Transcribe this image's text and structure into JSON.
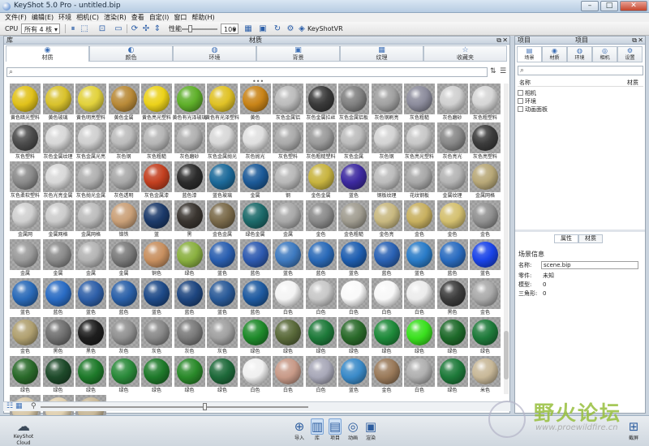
{
  "window": {
    "title": "KeyShot 5.0 Pro - untitled.bip",
    "minimize": "–",
    "maximize": "□",
    "close": "✕"
  },
  "menu": [
    "文件(F)",
    "编辑(E)",
    "环境",
    "相机(C)",
    "渲染(R)",
    "查看",
    "自定(I)",
    "窗口",
    "帮助(H)"
  ],
  "toolbar": {
    "cpu_label": "CPU",
    "cpu_value": "所有 4 核",
    "perf_label": "性能",
    "zoom_value": "100",
    "keyshotvr": "KeyShotVR"
  },
  "library": {
    "header_title": "库",
    "center_title": "材质",
    "tabs": [
      {
        "icon": "◉",
        "label": "材质"
      },
      {
        "icon": "◐",
        "label": "颜色"
      },
      {
        "icon": "◍",
        "label": "环境"
      },
      {
        "icon": "▣",
        "label": "背景"
      },
      {
        "icon": "▦",
        "label": "纹理"
      },
      {
        "icon": "☆",
        "label": "收藏夹"
      }
    ],
    "search_icon": "⌕",
    "sort_icons": [
      "⇅",
      "☰"
    ]
  },
  "materials": [
    {
      "label": "黄色暗光塑料",
      "color": "#e1c21a"
    },
    {
      "label": "黄色玻璃",
      "color": "#d9c22c"
    },
    {
      "label": "黄色明亮塑料",
      "color": "#e2d23c"
    },
    {
      "label": "黄色金属",
      "color": "#b98a38"
    },
    {
      "label": "黄色亮光塑料",
      "color": "#ecd21a"
    },
    {
      "label": "黄色有光泽玻璃",
      "color": "#5fb02a"
    },
    {
      "label": "黄色有光泽塑料",
      "color": "#e0c226"
    },
    {
      "label": "黄色",
      "color": "#c98418"
    },
    {
      "label": "灰色金属铝",
      "color": "#bcbcbc"
    },
    {
      "label": "灰色金属拉丝",
      "color": "#3a3a3a"
    },
    {
      "label": "灰色金属铝板",
      "color": "#808080"
    },
    {
      "label": "灰色钢刷亮",
      "color": "#a0a0a0"
    },
    {
      "label": "灰色粗糙",
      "color": "#8c8c9c"
    },
    {
      "label": "灰色磨砂",
      "color": "#d0d0d0"
    },
    {
      "label": "灰色粗塑料",
      "color": "#d6d6d6"
    },
    {
      "label": "灰色塑料",
      "color": "#4c4c4c"
    },
    {
      "label": "灰色金属纹理",
      "color": "#d8d8d8"
    },
    {
      "label": "灰色金属光亮",
      "color": "#d0d0d0"
    },
    {
      "label": "灰色钢",
      "color": "#bcbcbc"
    },
    {
      "label": "灰色粗糙",
      "color": "#b6b6b6"
    },
    {
      "label": "灰色磨砂",
      "color": "#b0b0b0"
    },
    {
      "label": "灰色金属抛光",
      "color": "#d8d8d8"
    },
    {
      "label": "灰色抛光",
      "color": "#e0e0e0"
    },
    {
      "label": "灰色塑料",
      "color": "#aaaaaa"
    },
    {
      "label": "灰色粗糙塑料",
      "color": "#9a9a9a"
    },
    {
      "label": "灰色金属",
      "color": "#bcbcbc"
    },
    {
      "label": "灰色钢",
      "color": "#d4d4d4"
    },
    {
      "label": "灰色亮光塑料",
      "color": "#c8c8c8"
    },
    {
      "label": "灰色亮光",
      "color": "#888888"
    },
    {
      "label": "灰色亮塑料",
      "color": "#3c3c3c"
    },
    {
      "label": "灰色柔软塑料",
      "color": "#8a8a8a"
    },
    {
      "label": "灰色光亮金属",
      "color": "#d8d8d8"
    },
    {
      "label": "灰色抛光金属",
      "color": "#b0b0b0"
    },
    {
      "label": "灰色透明",
      "color": "#a8a8a8"
    },
    {
      "label": "灰色金属漆",
      "color": "#c34020"
    },
    {
      "label": "蓝色漆",
      "color": "#2c2c2c"
    },
    {
      "label": "蓝色玻璃",
      "color": "#1c6a9a"
    },
    {
      "label": "金属",
      "color": "#1c5a98"
    },
    {
      "label": "钢",
      "color": "#b8b8b8"
    },
    {
      "label": "金色金属",
      "color": "#c8b440"
    },
    {
      "label": "蓝色",
      "color": "#3d2aa0"
    },
    {
      "label": "钢板纹理",
      "color": "#bcbcbc"
    },
    {
      "label": "花纹钢板",
      "color": "#a8a8a8"
    },
    {
      "label": "金属纹理",
      "color": "#b4b4b4"
    },
    {
      "label": "金属网格",
      "color": "#b8a878"
    },
    {
      "label": "金属网",
      "color": "#d0d0d0"
    },
    {
      "label": "金属网格",
      "color": "#cccccc"
    },
    {
      "label": "金属网格",
      "color": "#bcbcbc"
    },
    {
      "label": "铬铁",
      "color": "#caa078"
    },
    {
      "label": "蓝",
      "color": "#1c3a6a"
    },
    {
      "label": "黑",
      "color": "#3a3530"
    },
    {
      "label": "金色金属",
      "color": "#7a6a4a"
    },
    {
      "label": "绿色金属",
      "color": "#1c6a6a"
    },
    {
      "label": "金属",
      "color": "#a8a8a8"
    },
    {
      "label": "金色",
      "color": "#8a8a8a"
    },
    {
      "label": "金色粗糙",
      "color": "#a09c90"
    },
    {
      "label": "金色亮",
      "color": "#c8b880"
    },
    {
      "label": "金色",
      "color": "#c8b060"
    },
    {
      "label": "金色",
      "color": "#d4c070"
    },
    {
      "label": "金色",
      "color": "#909090"
    },
    {
      "label": "金属",
      "color": "#9a9a9a"
    },
    {
      "label": "金属",
      "color": "#8a8a8a"
    },
    {
      "label": "金属",
      "color": "#b4b4b4"
    },
    {
      "label": "金属",
      "color": "#7a7a7a"
    },
    {
      "label": "铜色",
      "color": "#c89060"
    },
    {
      "label": "绿色",
      "color": "#8ab040"
    },
    {
      "label": "蓝色",
      "color": "#2a5fb0"
    },
    {
      "label": "蓝色",
      "color": "#2e5ab0"
    },
    {
      "label": "蓝色",
      "color": "#3e7ac0"
    },
    {
      "label": "蓝色",
      "color": "#2a6ab8"
    },
    {
      "label": "蓝色",
      "color": "#1e5eb0"
    },
    {
      "label": "蓝色",
      "color": "#2a62b4"
    },
    {
      "label": "蓝色",
      "color": "#2a7cc8"
    },
    {
      "label": "蓝色",
      "color": "#2a6cc0"
    },
    {
      "label": "蓝色",
      "color": "#1a44e8"
    },
    {
      "label": "蓝色",
      "color": "#2a6ab8"
    },
    {
      "label": "蓝色",
      "color": "#2a6cc4"
    },
    {
      "label": "蓝色",
      "color": "#2e5fa8"
    },
    {
      "label": "蓝色",
      "color": "#2a60a8"
    },
    {
      "label": "蓝色",
      "color": "#1e4a88"
    },
    {
      "label": "蓝色",
      "color": "#1e4680"
    },
    {
      "label": "蓝色",
      "color": "#2a5a98"
    },
    {
      "label": "蓝色",
      "color": "#1e5aa0"
    },
    {
      "label": "白色",
      "color": "#f4f4f4"
    },
    {
      "label": "白色",
      "color": "#c8c8c8"
    },
    {
      "label": "白色",
      "color": "#fafafa"
    },
    {
      "label": "白色",
      "color": "#f8f8f8"
    },
    {
      "label": "白色",
      "color": "#ececec"
    },
    {
      "label": "黑色",
      "color": "#3c3c3c"
    },
    {
      "label": "金色",
      "color": "#aaaaaa"
    },
    {
      "label": "金色",
      "color": "#b0a070"
    },
    {
      "label": "黑色",
      "color": "#707070"
    },
    {
      "label": "黑色",
      "color": "#1e1e1e"
    },
    {
      "label": "灰色",
      "color": "#909090"
    },
    {
      "label": "灰色",
      "color": "#888888"
    },
    {
      "label": "灰色",
      "color": "#7a7a7a"
    },
    {
      "label": "灰色",
      "color": "#a0a0a0"
    },
    {
      "label": "绿色",
      "color": "#1e8a2a"
    },
    {
      "label": "绿色",
      "color": "#5a6a3a"
    },
    {
      "label": "绿色",
      "color": "#1e7a3a"
    },
    {
      "label": "绿色",
      "color": "#2a6a2a"
    },
    {
      "label": "绿色",
      "color": "#1e8a3a"
    },
    {
      "label": "绿色",
      "color": "#3ae01e"
    },
    {
      "label": "绿色",
      "color": "#1e6a2a"
    },
    {
      "label": "绿色",
      "color": "#1e7a3a"
    },
    {
      "label": "绿色",
      "color": "#2a6a2a"
    },
    {
      "label": "绿色",
      "color": "#1e4a2a"
    },
    {
      "label": "绿色",
      "color": "#1e7a2a"
    },
    {
      "label": "绿色",
      "color": "#2a8a3a"
    },
    {
      "label": "绿色",
      "color": "#1e7a2a"
    },
    {
      "label": "绿色",
      "color": "#2a8a2a"
    },
    {
      "label": "绿色",
      "color": "#1e6a3a"
    },
    {
      "label": "白色",
      "color": "#f0f0f0"
    },
    {
      "label": "白色",
      "color": "#c89a88"
    },
    {
      "label": "白色",
      "color": "#a8a8b8"
    },
    {
      "label": "蓝色",
      "color": "#3a8ac8"
    },
    {
      "label": "金色",
      "color": "#9a7a5a"
    },
    {
      "label": "白色",
      "color": "#b0b0b0"
    },
    {
      "label": "绿色",
      "color": "#1e7a3a"
    },
    {
      "label": "米色",
      "color": "#c8b898"
    },
    {
      "label": "米色",
      "color": "#d8c8a8"
    },
    {
      "label": "米色",
      "color": "#e0d0b0"
    },
    {
      "label": "米色",
      "color": "#c8b898"
    }
  ],
  "right": {
    "header_title": "项目",
    "tabs": [
      {
        "icon": "▤",
        "label": "场景"
      },
      {
        "icon": "◉",
        "label": "材质"
      },
      {
        "icon": "◍",
        "label": "环境"
      },
      {
        "icon": "◎",
        "label": "相机"
      },
      {
        "icon": "⚙",
        "label": "设置"
      }
    ],
    "tree_col1": "名称",
    "tree_col2": "材质",
    "tree": [
      "相机",
      "环境",
      "动画面板"
    ],
    "prop_tabs": [
      "属性",
      "材质"
    ],
    "prop_title": "场景信息",
    "name_label": "名称:",
    "name_value": "scene.bip",
    "props": [
      {
        "k": "零件:",
        "v": "未知"
      },
      {
        "k": "模型:",
        "v": "0"
      },
      {
        "k": "三角形:",
        "v": "0"
      }
    ]
  },
  "bottom": {
    "cloud_label": "KeyShot Cloud",
    "buttons": [
      {
        "icon": "⊕",
        "label": "导入"
      },
      {
        "icon": "▥",
        "label": "库"
      },
      {
        "icon": "▤",
        "label": "项目"
      },
      {
        "icon": "◎",
        "label": "动画"
      },
      {
        "icon": "▣",
        "label": "渲染"
      }
    ],
    "screenshot_label": "截屏"
  },
  "watermark": {
    "title": "野火论坛",
    "url": "www.proewildfire.cn"
  }
}
